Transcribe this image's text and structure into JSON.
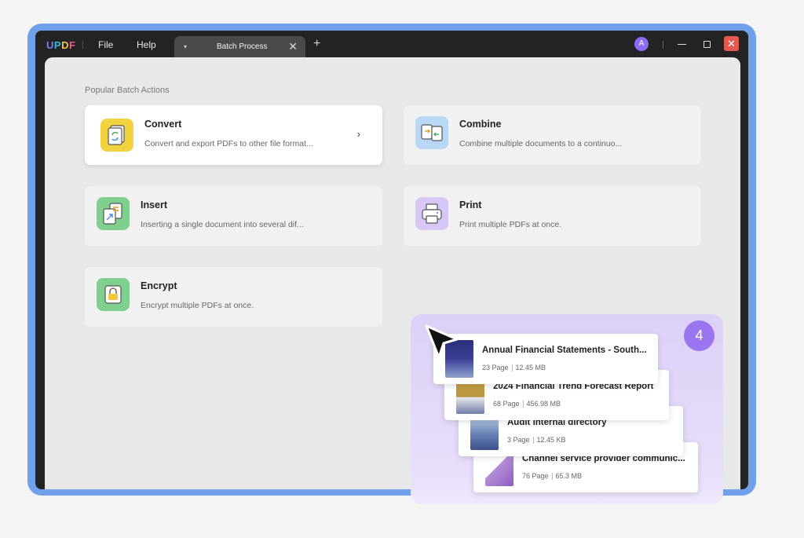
{
  "app": {
    "logo": [
      "U",
      "P",
      "D",
      "F"
    ],
    "menu": [
      "File",
      "Help"
    ],
    "tab": {
      "dropdown": "▾",
      "label": "Batch Process",
      "close": "✕"
    },
    "new_tab": "+",
    "avatar": "A",
    "close_symbol": "✕"
  },
  "section_title": "Popular Batch Actions",
  "actions": {
    "convert": {
      "title": "Convert",
      "desc": "Convert and export PDFs to other file format...",
      "chevron": "›"
    },
    "combine": {
      "title": "Combine",
      "desc": "Combine multiple documents to a continuo..."
    },
    "insert": {
      "title": "Insert",
      "desc": "Inserting a single document into several dif..."
    },
    "print": {
      "title": "Print",
      "desc": "Print multiple PDFs at once."
    },
    "encrypt": {
      "title": "Encrypt",
      "desc": "Encrypt multiple PDFs at once."
    }
  },
  "selection_count": "4",
  "files": [
    {
      "name": "Annual Financial Statements - South...",
      "pages": "23 Page",
      "size": "12.45 MB"
    },
    {
      "name": "2024 Financial Trend Forecast Report",
      "pages": "68 Page",
      "size": "456.98 MB"
    },
    {
      "name": "Audit internal directory",
      "pages": "3 Page",
      "size": "12.45 KB"
    },
    {
      "name": "Channel service provider communic...",
      "pages": "76 Page",
      "size": "65.3 MB"
    }
  ],
  "colors": {
    "device_frame": "#6fa0ea",
    "accent_purple": "#9b74f0",
    "convert_icon": "#f2d23e",
    "combine_icon": "#b8d8f5",
    "insert_icon": "#7fd08f",
    "print_icon": "#d7c6f6",
    "encrypt_icon": "#7fd08f"
  },
  "icons": {
    "convert": "convert-icon",
    "combine": "combine-icon",
    "insert": "insert-icon",
    "print": "print-icon",
    "encrypt": "lock-icon",
    "cursor": "pointer-cursor-icon"
  }
}
